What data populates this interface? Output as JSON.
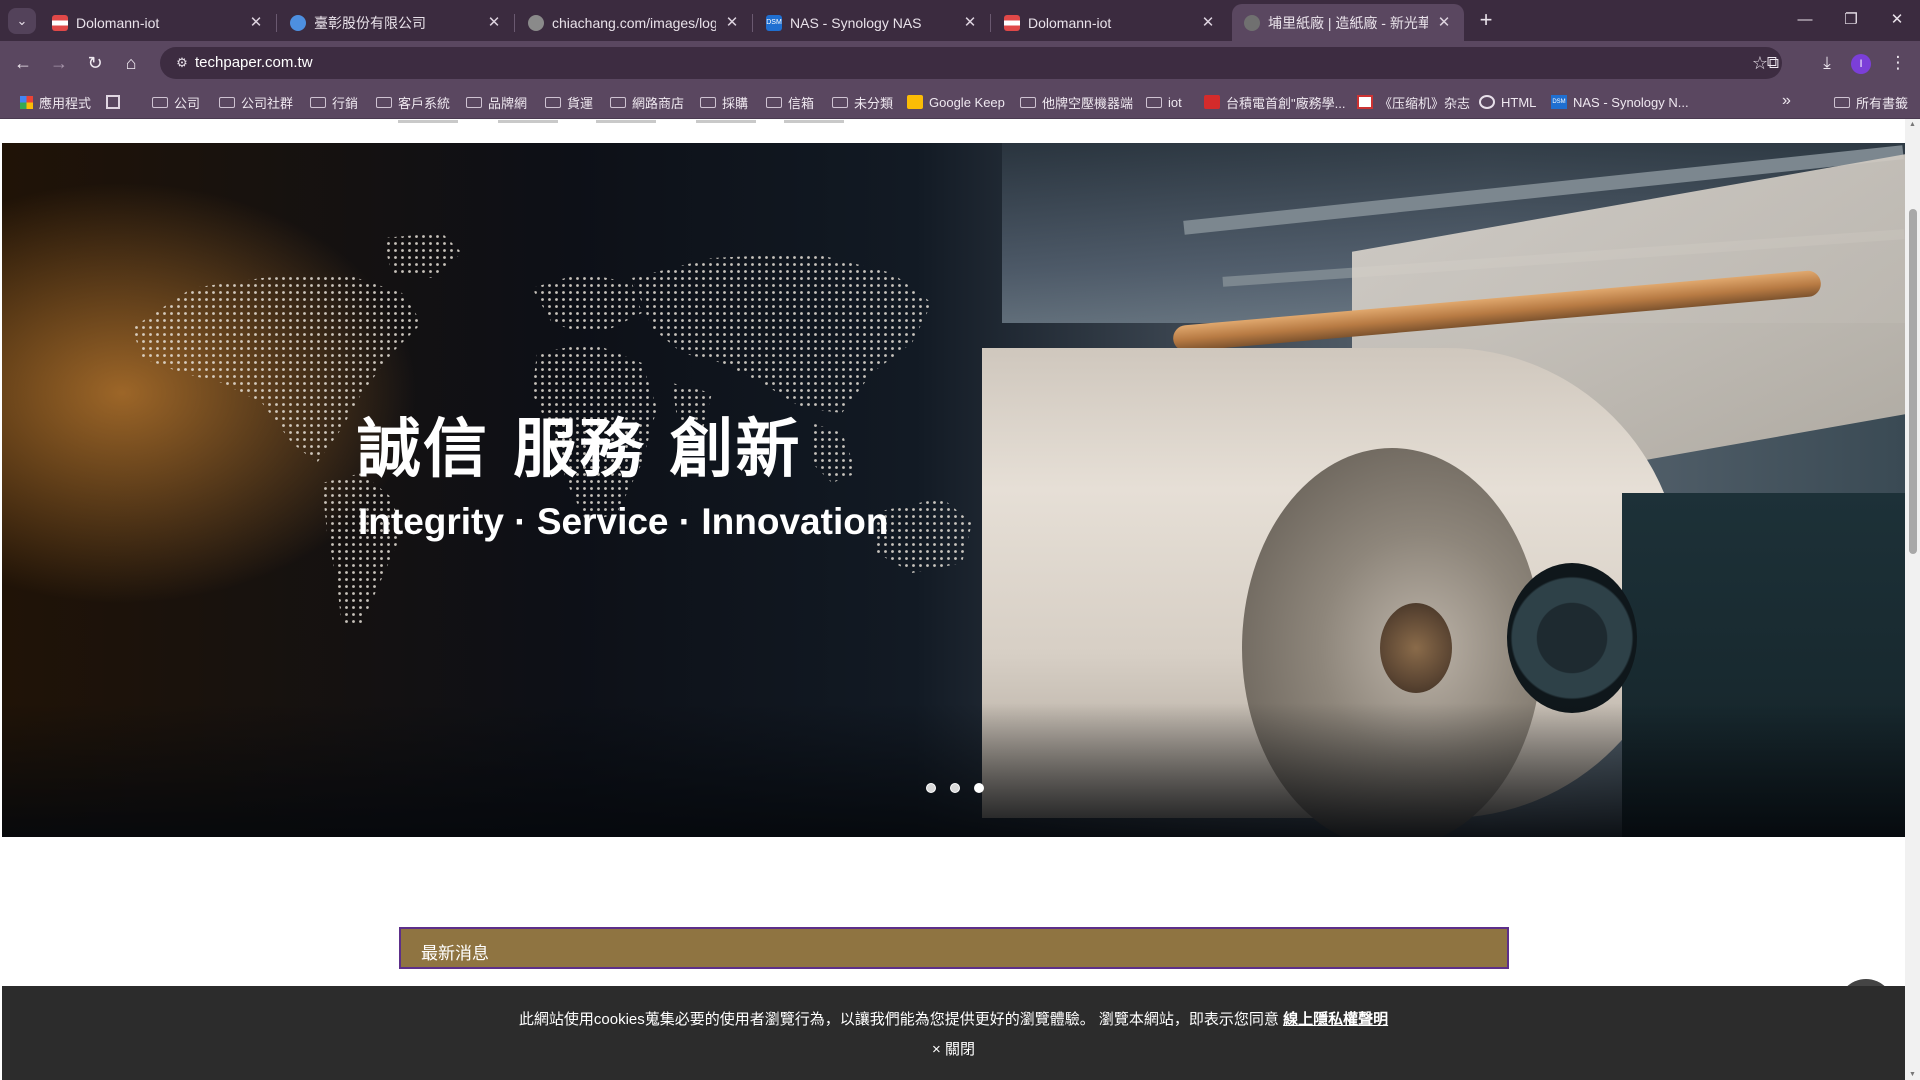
{
  "browser": {
    "tabs": [
      {
        "title": "Dolomann-iot",
        "favicon_color": "#e04848"
      },
      {
        "title": "臺彰股份有限公司",
        "favicon_color": "#4d8fe0"
      },
      {
        "title": "chiachang.com/images/logo",
        "favicon_color": "#8a8a8a"
      },
      {
        "title": "NAS - Synology NAS",
        "favicon_color": "#1f6fd1"
      },
      {
        "title": "Dolomann-iot",
        "favicon_color": "#e04848"
      },
      {
        "title": "埔里紙廠 | 造紙廠 - 新光華造紙",
        "favicon_color": "#707070"
      }
    ],
    "url": "techpaper.com.tw",
    "avatar_letter": "I",
    "bookmarks": [
      {
        "label": "應用程式",
        "icon": "apps-grid-icon"
      },
      {
        "label": "",
        "icon": "grid-icon"
      },
      {
        "label": "公司",
        "icon": "folder-icon"
      },
      {
        "label": "公司社群",
        "icon": "folder-icon"
      },
      {
        "label": "行銷",
        "icon": "folder-icon"
      },
      {
        "label": "客戶系統",
        "icon": "folder-icon"
      },
      {
        "label": "品牌網",
        "icon": "folder-icon"
      },
      {
        "label": "貨運",
        "icon": "folder-icon"
      },
      {
        "label": "網路商店",
        "icon": "folder-icon"
      },
      {
        "label": "採購",
        "icon": "folder-icon"
      },
      {
        "label": "信箱",
        "icon": "folder-icon"
      },
      {
        "label": "未分類",
        "icon": "folder-icon"
      },
      {
        "label": "Google Keep",
        "icon": "keep-icon"
      },
      {
        "label": "他牌空壓機器端",
        "icon": "folder-icon"
      },
      {
        "label": "iot",
        "icon": "folder-icon"
      },
      {
        "label": "台積電首創\"廠務學...",
        "icon": "red-site-icon"
      },
      {
        "label": "《压缩机》杂志",
        "icon": "magazine-icon"
      },
      {
        "label": "HTML",
        "icon": "html-icon"
      },
      {
        "label": "NAS - Synology N...",
        "icon": "dsm-icon"
      }
    ],
    "all_bookmarks": "所有書籤"
  },
  "hero": {
    "title": "誠信 服務 創新",
    "subtitle": "Integrity · Service · Innovation",
    "slide_count": 3,
    "active_slide": 3
  },
  "news": {
    "heading": "最新消息"
  },
  "cookie": {
    "message": "此網站使用cookies蒐集必要的使用者瀏覽行為，以讓我們能為您提供更好的瀏覽體驗。 瀏覽本網站，即表示您同意 ",
    "link_text": "線上隱私權聲明",
    "close_label": "× 關閉"
  },
  "colors": {
    "news_bar": "#8f7441",
    "news_border": "#5d2f8a",
    "cookie_bg": "#2c2c2c",
    "chrome_toolbar": "#5a4760"
  }
}
